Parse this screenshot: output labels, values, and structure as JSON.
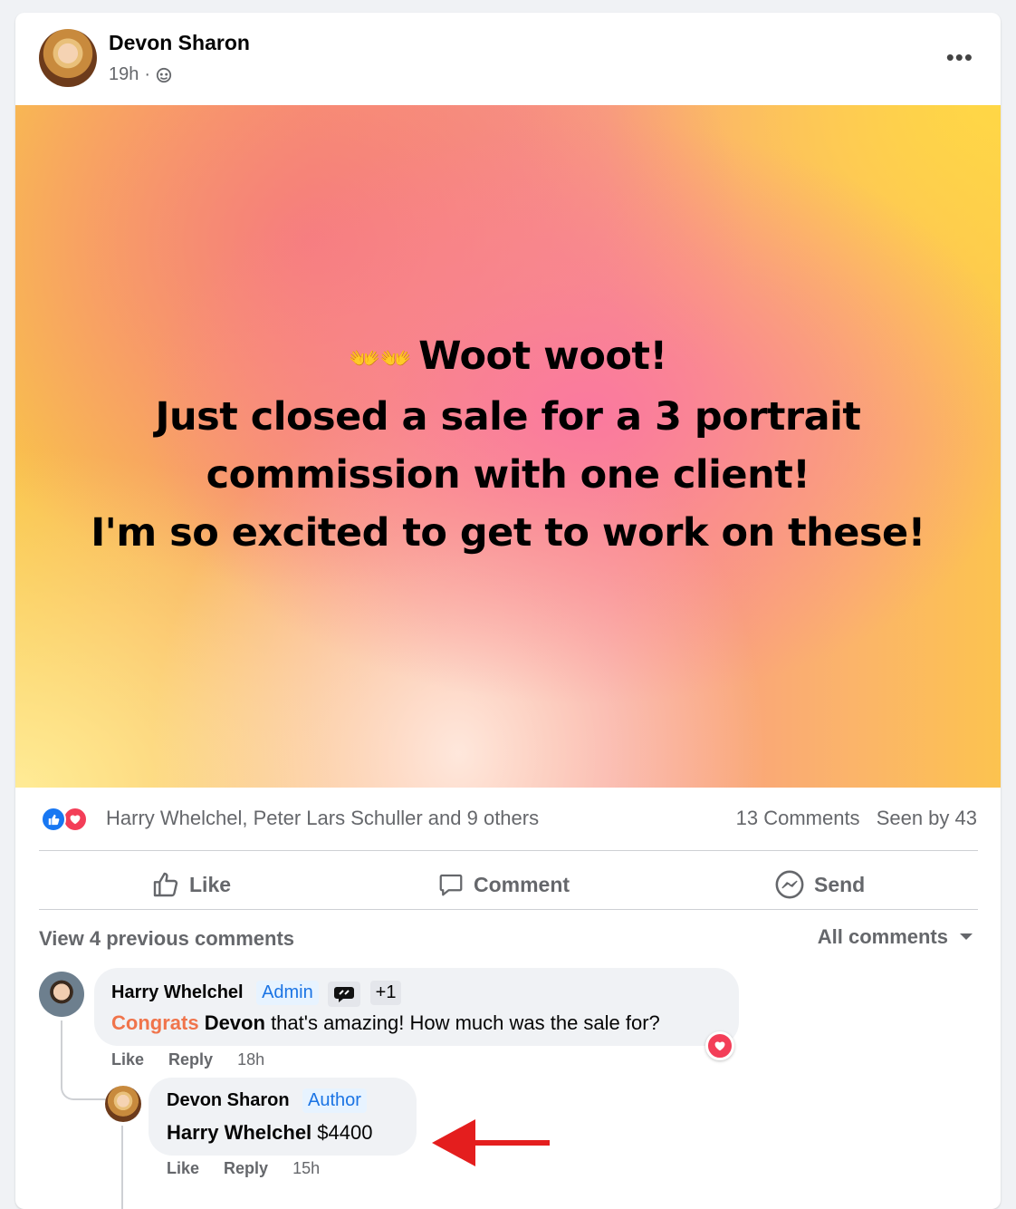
{
  "post": {
    "author": "Devon Sharon",
    "time": "19h",
    "separator": "·",
    "body_lines": [
      "Woot woot!",
      "Just closed a sale for a 3 portrait",
      "commission with one client!",
      "I'm so excited to get to work on these!"
    ],
    "clap_emoji": "👐👐"
  },
  "reactions": {
    "names": "Harry Whelchel, Peter Lars Schuller and 9 others",
    "comments": "13 Comments",
    "seen": "Seen by 43"
  },
  "actions": {
    "like": "Like",
    "comment": "Comment",
    "send": "Send"
  },
  "comments_header": {
    "view_previous": "View 4 previous comments",
    "filter": "All comments"
  },
  "comments": [
    {
      "author": "Harry Whelchel",
      "badge": "Admin",
      "extra": "+1",
      "text_highlight": "Congrats",
      "text_mention": "Devon",
      "text_rest": "that's amazing! How much was the sale for?",
      "like": "Like",
      "reply": "Reply",
      "time": "18h"
    },
    {
      "author": "Devon Sharon",
      "badge": "Author",
      "text_mention": "Harry Whelchel",
      "text_rest": "$4400",
      "like": "Like",
      "reply": "Reply",
      "time": "15h"
    }
  ],
  "colors": {
    "accent": "#1877f2",
    "love": "#f33e58",
    "arrow": "#e41e1e",
    "congrats": "#f0744b"
  }
}
